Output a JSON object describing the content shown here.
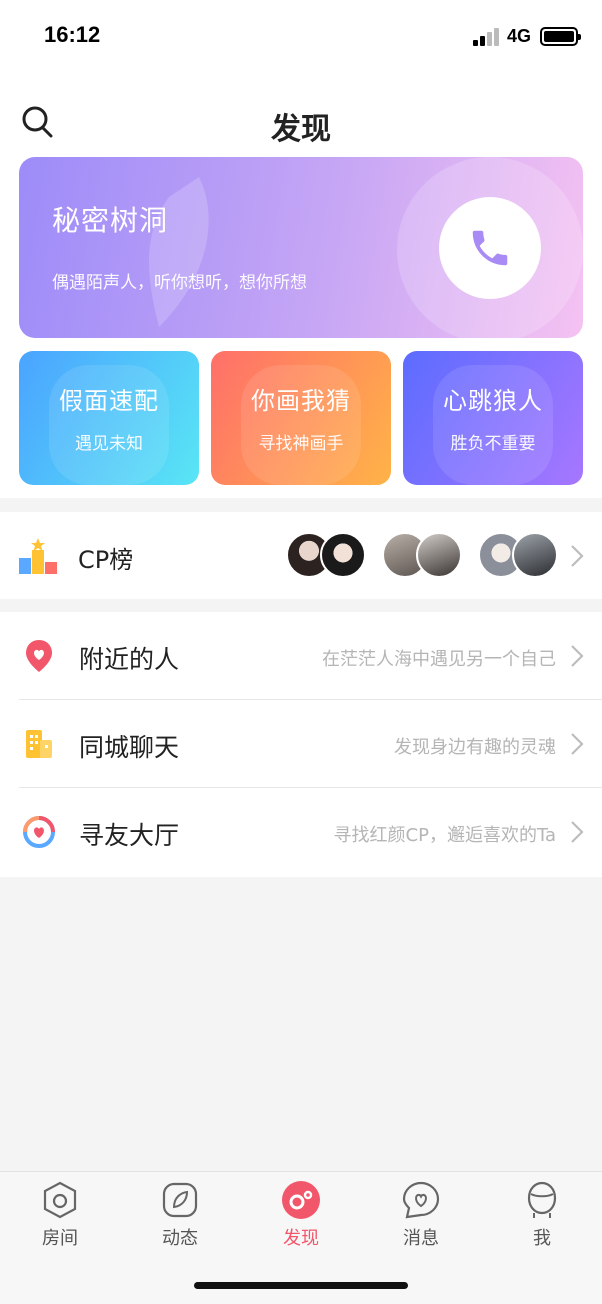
{
  "status_bar": {
    "time": "16:12",
    "network": "4G"
  },
  "header": {
    "title": "发现"
  },
  "hero": {
    "title": "秘密树洞",
    "subtitle": "偶遇陌声人，听你想听，想你所想",
    "call_icon": "phone-icon"
  },
  "cards": [
    {
      "title": "假面速配",
      "subtitle": "遇见未知"
    },
    {
      "title": "你画我猜",
      "subtitle": "寻找神画手"
    },
    {
      "title": "心跳狼人",
      "subtitle": "胜负不重要"
    }
  ],
  "cp_rank": {
    "label": "CP榜",
    "icon": "podium-icon",
    "pairs": 3
  },
  "list": [
    {
      "label": "附近的人",
      "desc": "在茫茫人海中遇见另一个自己",
      "icon": "location-pin-icon",
      "color": "#f2566b"
    },
    {
      "label": "同城聊天",
      "desc": "发现身边有趣的灵魂",
      "icon": "building-icon",
      "color": "#ffc233"
    },
    {
      "label": "寻友大厅",
      "desc": "寻找红颜CP，邂逅喜欢的Ta",
      "icon": "hall-icon",
      "color": "#f2566b"
    }
  ],
  "tabs": [
    {
      "label": "房间",
      "icon": "room-icon"
    },
    {
      "label": "动态",
      "icon": "leaf-icon"
    },
    {
      "label": "发现",
      "icon": "discover-icon",
      "active": true
    },
    {
      "label": "消息",
      "icon": "message-heart-icon"
    },
    {
      "label": "我",
      "icon": "profile-icon"
    }
  ],
  "colors": {
    "accent": "#f2566b",
    "hero_start": "#9d8cf8",
    "hero_end": "#f5c2f2"
  }
}
